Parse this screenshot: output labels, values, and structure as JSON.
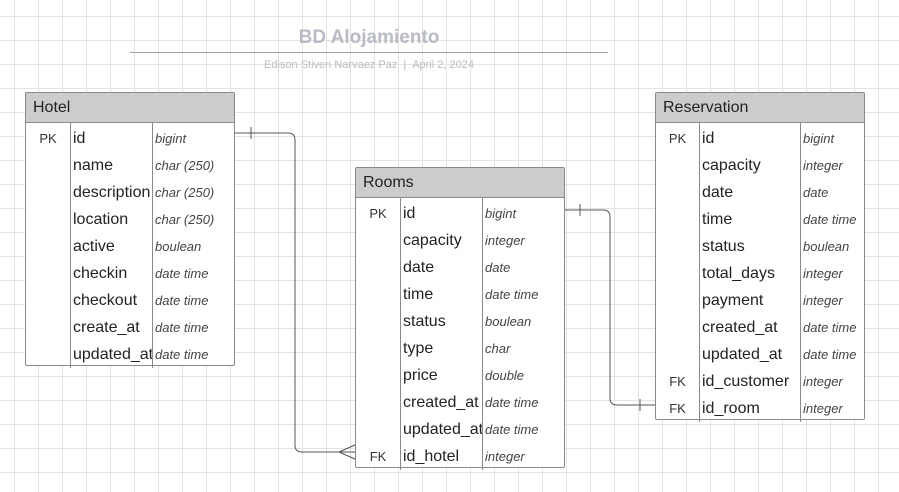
{
  "diagram": {
    "title": "BD Alojamiento",
    "author": "Edison Stiven Narvaez Paz",
    "separator": "|",
    "date": "April 2, 2024"
  },
  "entities": [
    {
      "id": "hotel",
      "name": "Hotel",
      "fields": [
        {
          "key": "PK",
          "name": "id",
          "type": "bigint"
        },
        {
          "key": "",
          "name": "name",
          "type": "char (250)"
        },
        {
          "key": "",
          "name": "description",
          "type": "char (250)"
        },
        {
          "key": "",
          "name": "location",
          "type": "char (250)"
        },
        {
          "key": "",
          "name": "active",
          "type": "boulean"
        },
        {
          "key": "",
          "name": "checkin",
          "type": "date time"
        },
        {
          "key": "",
          "name": "checkout",
          "type": "date time"
        },
        {
          "key": "",
          "name": "create_at",
          "type": "date time"
        },
        {
          "key": "",
          "name": "updated_at",
          "type": "date time"
        }
      ]
    },
    {
      "id": "rooms",
      "name": "Rooms",
      "fields": [
        {
          "key": "PK",
          "name": "id",
          "type": "bigint"
        },
        {
          "key": "",
          "name": "capacity",
          "type": "integer"
        },
        {
          "key": "",
          "name": "date",
          "type": "date"
        },
        {
          "key": "",
          "name": "time",
          "type": "date time"
        },
        {
          "key": "",
          "name": "status",
          "type": "boulean"
        },
        {
          "key": "",
          "name": "type",
          "type": "char"
        },
        {
          "key": "",
          "name": "price",
          "type": "double"
        },
        {
          "key": "",
          "name": "created_at",
          "type": "date time"
        },
        {
          "key": "",
          "name": "updated_at",
          "type": "date time"
        },
        {
          "key": "FK",
          "name": "id_hotel",
          "type": "integer"
        }
      ]
    },
    {
      "id": "reservation",
      "name": "Reservation",
      "fields": [
        {
          "key": "PK",
          "name": "id",
          "type": "bigint"
        },
        {
          "key": "",
          "name": "capacity",
          "type": "integer"
        },
        {
          "key": "",
          "name": "date",
          "type": "date"
        },
        {
          "key": "",
          "name": "time",
          "type": "date time"
        },
        {
          "key": "",
          "name": "status",
          "type": "boulean"
        },
        {
          "key": "",
          "name": "total_days",
          "type": "integer"
        },
        {
          "key": "",
          "name": "payment",
          "type": "integer"
        },
        {
          "key": "",
          "name": "created_at",
          "type": "date time"
        },
        {
          "key": "",
          "name": "updated_at",
          "type": "date time"
        },
        {
          "key": "FK",
          "name": "id_customer",
          "type": "integer"
        },
        {
          "key": "FK",
          "name": "id_room",
          "type": "integer"
        }
      ]
    }
  ],
  "relationships": [
    {
      "from": "hotel.id",
      "to": "rooms.id_hotel",
      "from_end": "one",
      "to_end": "many"
    },
    {
      "from": "rooms.id",
      "to": "reservation.id_room",
      "from_end": "one",
      "to_end": "one"
    }
  ],
  "colors": {
    "header_fill": "#cccccc",
    "border": "#8a8a8a",
    "title": "#b9bcc4",
    "connector": "#555555",
    "grid": "#e3e3e3"
  }
}
